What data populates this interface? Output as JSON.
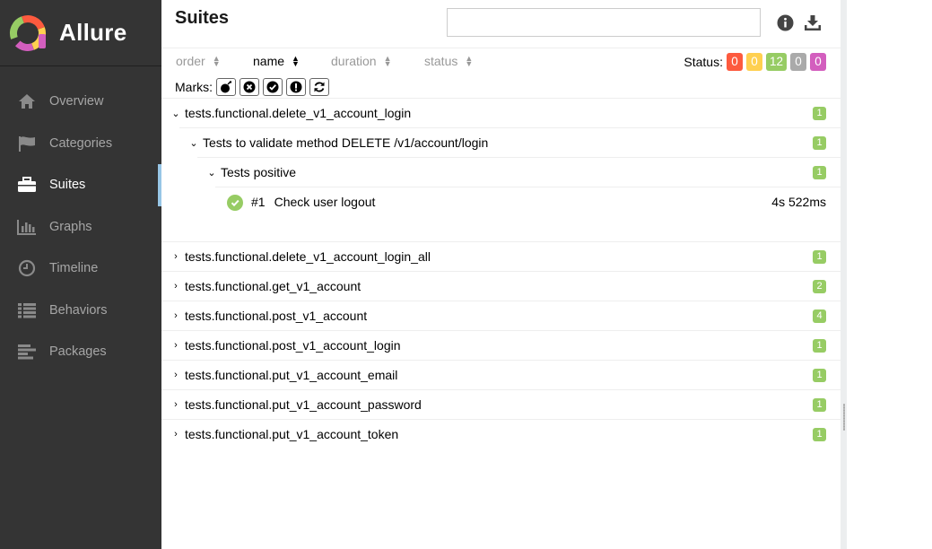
{
  "app": {
    "name": "Allure"
  },
  "sidebar": {
    "items": [
      {
        "label": "Overview",
        "icon": "home-icon",
        "active": false
      },
      {
        "label": "Categories",
        "icon": "flag-icon",
        "active": false
      },
      {
        "label": "Suites",
        "icon": "briefcase-icon",
        "active": true
      },
      {
        "label": "Graphs",
        "icon": "bar-chart-icon",
        "active": false
      },
      {
        "label": "Timeline",
        "icon": "clock-icon",
        "active": false
      },
      {
        "label": "Behaviors",
        "icon": "list-icon",
        "active": false
      },
      {
        "label": "Packages",
        "icon": "align-left-icon",
        "active": false
      }
    ]
  },
  "pane": {
    "title": "Suites",
    "search": {
      "value": "",
      "placeholder": ""
    },
    "sort": {
      "order": "order",
      "name": "name",
      "duration": "duration",
      "status": "status"
    },
    "status_label": "Status:",
    "status_counts": [
      {
        "value": "0",
        "color": "#fd5a3e",
        "status": "failed"
      },
      {
        "value": "0",
        "color": "#ffd050",
        "status": "broken"
      },
      {
        "value": "12",
        "color": "#97cc64",
        "status": "passed"
      },
      {
        "value": "0",
        "color": "#aaaaaa",
        "status": "skipped"
      },
      {
        "value": "0",
        "color": "#d35ebe",
        "status": "unknown"
      }
    ],
    "marks_label": "Marks:",
    "marks": [
      "flaky-bomb-icon",
      "new-failed-icon",
      "new-passed-icon",
      "new-broken-icon",
      "retries-icon"
    ]
  },
  "tree": {
    "expanded": {
      "suite": "tests.functional.delete_v1_account_login",
      "suite_count": "1",
      "class": "Tests to validate method DELETE /v1/account/login",
      "class_count": "1",
      "group": "Tests positive",
      "group_count": "1",
      "test": {
        "order": "#1",
        "name": "Check user logout",
        "duration": "4s 522ms"
      }
    },
    "collapsed": [
      {
        "name": "tests.functional.delete_v1_account_login_all",
        "count": "1"
      },
      {
        "name": "tests.functional.get_v1_account",
        "count": "2"
      },
      {
        "name": "tests.functional.post_v1_account",
        "count": "4"
      },
      {
        "name": "tests.functional.post_v1_account_login",
        "count": "1"
      },
      {
        "name": "tests.functional.put_v1_account_email",
        "count": "1"
      },
      {
        "name": "tests.functional.put_v1_account_password",
        "count": "1"
      },
      {
        "name": "tests.functional.put_v1_account_token",
        "count": "1"
      }
    ]
  }
}
